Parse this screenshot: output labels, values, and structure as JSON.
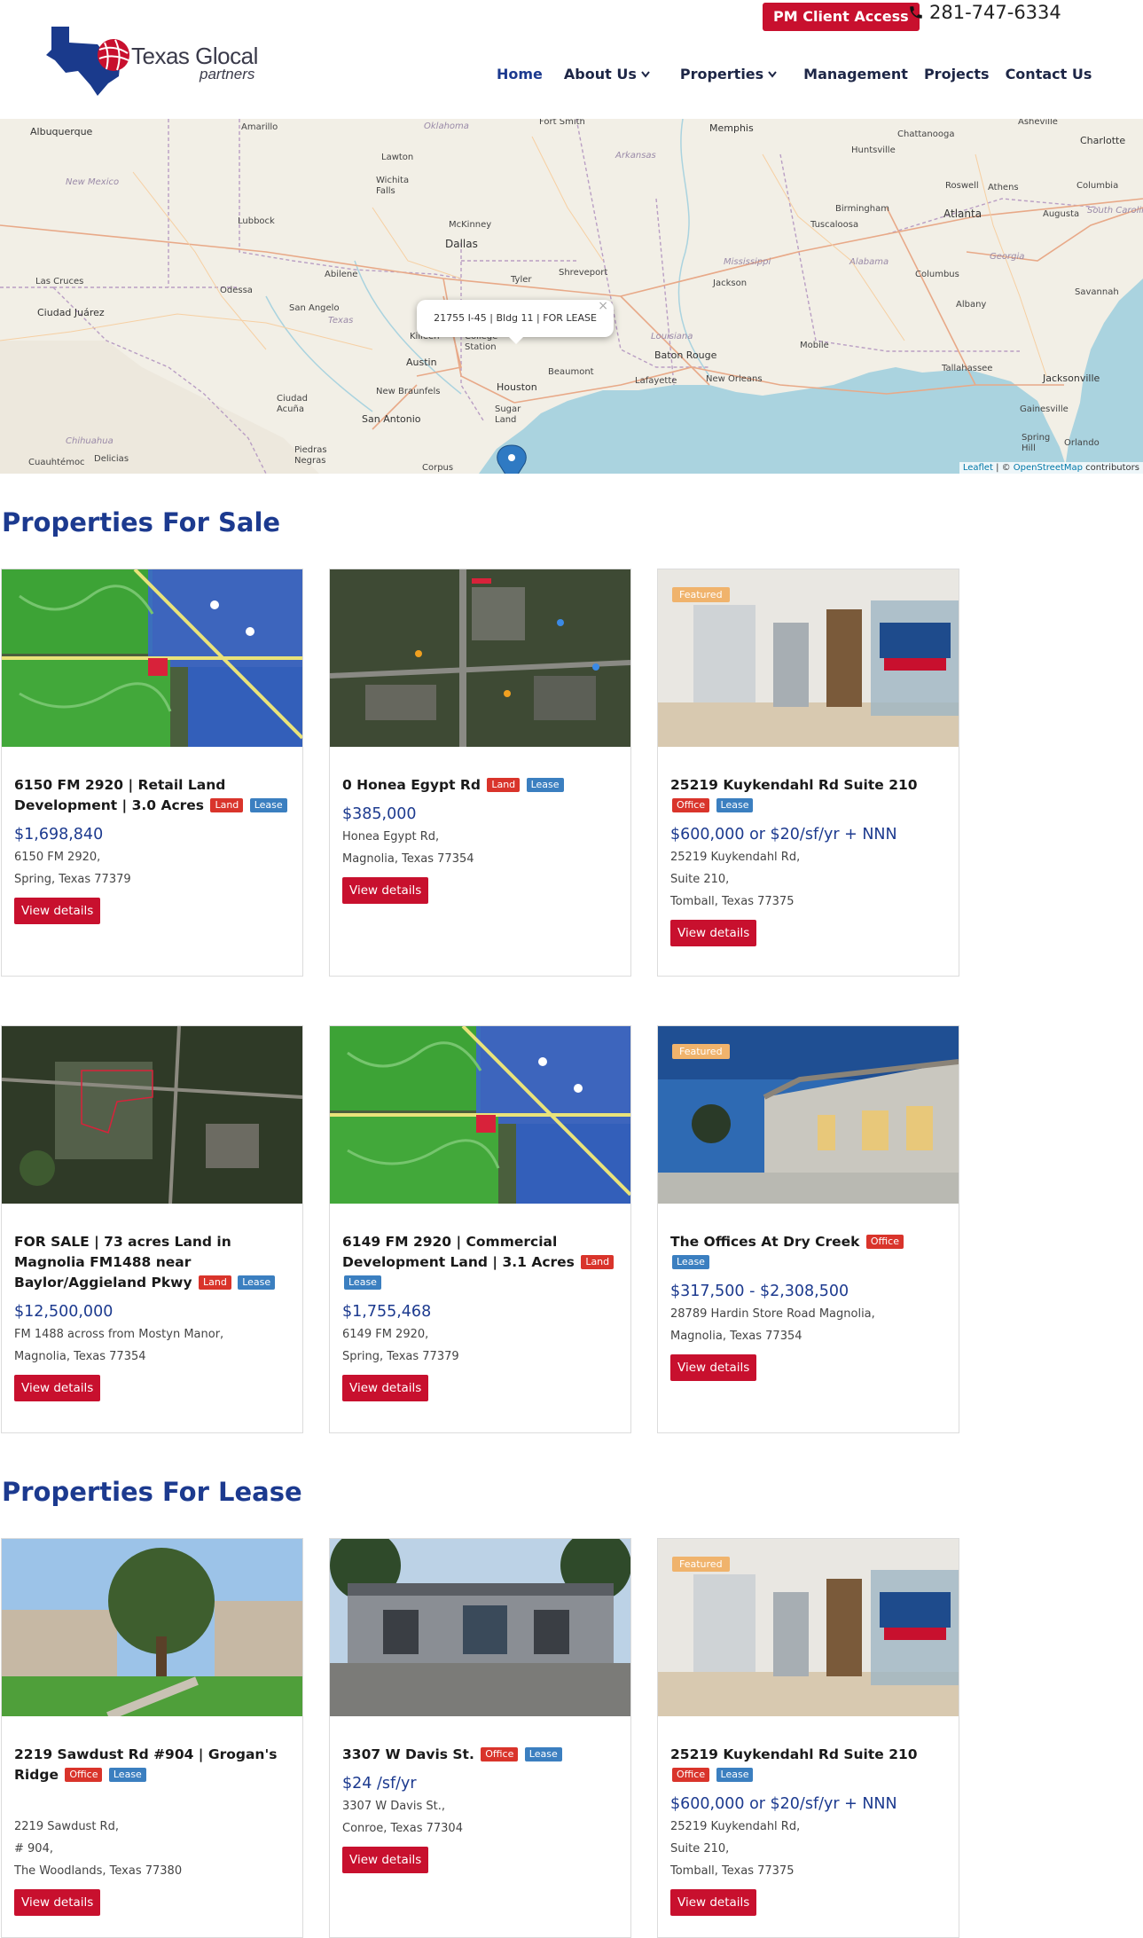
{
  "header": {
    "logo_line1": "Texas Glocal",
    "logo_line2": "partners",
    "pm_client_access": "PM Client Access",
    "phone": "281-747-6334",
    "nav": [
      {
        "label": "Home",
        "dropdown": false,
        "active": true
      },
      {
        "label": "About Us",
        "dropdown": true,
        "active": false
      },
      {
        "label": "Properties",
        "dropdown": true,
        "active": false
      },
      {
        "label": "Management",
        "dropdown": false,
        "active": false
      },
      {
        "label": "Projects",
        "dropdown": false,
        "active": false
      },
      {
        "label": "Contact Us",
        "dropdown": false,
        "active": false
      }
    ]
  },
  "map": {
    "popup_text": "21755 I-45 | Bldg 11 | FOR LEASE",
    "popup_close": "×",
    "attribution_leaflet": "Leaflet",
    "attribution_sep": " | © ",
    "attribution_osm": "OpenStreetMap",
    "attribution_tail": " contributors",
    "cities": [
      "Albuquerque",
      "Amarillo",
      "Oklahoma",
      "Fort Smith",
      "Memphis",
      "Chattanooga",
      "Asheville",
      "Charlotte",
      "Lawton",
      "Arkansas",
      "Huntsville",
      "New Mexico",
      "Wichita Falls",
      "Birmingham",
      "Atlanta",
      "Athens",
      "Columbia",
      "Roswell",
      "Lubbock",
      "McKinney",
      "Tuscaloosa",
      "Augusta",
      "South Carolina",
      "Dallas",
      "Alabama",
      "Georgia",
      "Mississippi",
      "Abilene",
      "Tyler",
      "Shreveport",
      "Jackson",
      "Columbus",
      "Las Cruces",
      "Odessa",
      "Savannah",
      "Ciudad Juárez",
      "San Angelo",
      "Texas",
      "Albany",
      "Killeen",
      "College Station",
      "Louisiana",
      "Mobile",
      "Austin",
      "Beaumont",
      "Baton Rouge",
      "Tallahassee",
      "Jacksonville",
      "New Braunfels",
      "Houston",
      "Lafayette",
      "New Orleans",
      "Ciudad Acuña",
      "San Antonio",
      "Sugar Land",
      "Gainesville",
      "Chihuahua",
      "Spring Hill",
      "Orlando",
      "Cuauhtémoc",
      "Delicias",
      "Piedras Negras",
      "Corpus"
    ]
  },
  "sale": {
    "title": "Properties For Sale",
    "cards": [
      {
        "title": "6150 FM 2920 | Retail Land Development | 3.0 Acres",
        "badges": [
          "Land",
          "Lease"
        ],
        "price": "$1,698,840",
        "address": [
          "6150 FM 2920,",
          "Spring, Texas 77379"
        ],
        "featured": false,
        "image": "aerial-retail",
        "button": "View details"
      },
      {
        "title": "0 Honea Egypt Rd",
        "badges": [
          "Land",
          "Lease"
        ],
        "price": "$385,000",
        "address": [
          "Honea Egypt Rd,",
          "Magnolia, Texas 77354"
        ],
        "featured": false,
        "image": "aerial-satellite",
        "button": "View details"
      },
      {
        "title": "25219 Kuykendahl Rd Suite 210",
        "badges": [
          "Office",
          "Lease"
        ],
        "price": "$600,000 or $20/sf/yr + NNN",
        "address": [
          "25219 Kuykendahl Rd,",
          "Suite 210,",
          "Tomball, Texas 77375"
        ],
        "featured": true,
        "featured_label": "Featured",
        "image": "interior",
        "button": "View details"
      },
      {
        "title": "FOR SALE | 73 acres Land in Magnolia FM1488 near Baylor/Aggieland Pkwy",
        "badges": [
          "Land",
          "Lease"
        ],
        "price": "$12,500,000",
        "address": [
          "FM 1488 across from Mostyn Manor,",
          "Magnolia, Texas 77354"
        ],
        "featured": false,
        "image": "aerial-forest",
        "button": "View details"
      },
      {
        "title": "6149 FM 2920 | Commercial Development Land | 3.1 Acres",
        "badges": [
          "Land",
          "Lease"
        ],
        "price": "$1,755,468",
        "address": [
          "6149 FM 2920,",
          "Spring, Texas 77379"
        ],
        "featured": false,
        "image": "aerial-retail",
        "button": "View details"
      },
      {
        "title": "The Offices At Dry Creek",
        "badges": [
          "Office",
          "Lease"
        ],
        "price": "$317,500 - $2,308,500",
        "address": [
          "28789 Hardin Store Road Magnolia,",
          "Magnolia, Texas 77354"
        ],
        "featured": true,
        "featured_label": "Featured",
        "image": "building-dusk",
        "button": "View details"
      }
    ]
  },
  "lease": {
    "title": "Properties For Lease",
    "cards": [
      {
        "title": "2219 Sawdust Rd #904 | Grogan's Ridge",
        "badges": [
          "Office",
          "Lease"
        ],
        "price": "",
        "address": [
          "2219 Sawdust Rd,",
          "# 904,",
          "The Woodlands, Texas 77380"
        ],
        "featured": false,
        "image": "office-tree",
        "button": "View details"
      },
      {
        "title": "3307 W Davis St.",
        "badges": [
          "Office",
          "Lease"
        ],
        "price": "$24 /sf/yr",
        "address": [
          "3307 W Davis St.,",
          "Conroe, Texas 77304"
        ],
        "featured": false,
        "image": "office-stone",
        "button": "View details"
      },
      {
        "title": "25219 Kuykendahl Rd Suite 210",
        "badges": [
          "Office",
          "Lease"
        ],
        "price": "$600,000 or $20/sf/yr + NNN",
        "address": [
          "25219 Kuykendahl Rd,",
          "Suite 210,",
          "Tomball, Texas 77375"
        ],
        "featured": true,
        "featured_label": "Featured",
        "image": "interior",
        "button": "View details"
      }
    ]
  }
}
